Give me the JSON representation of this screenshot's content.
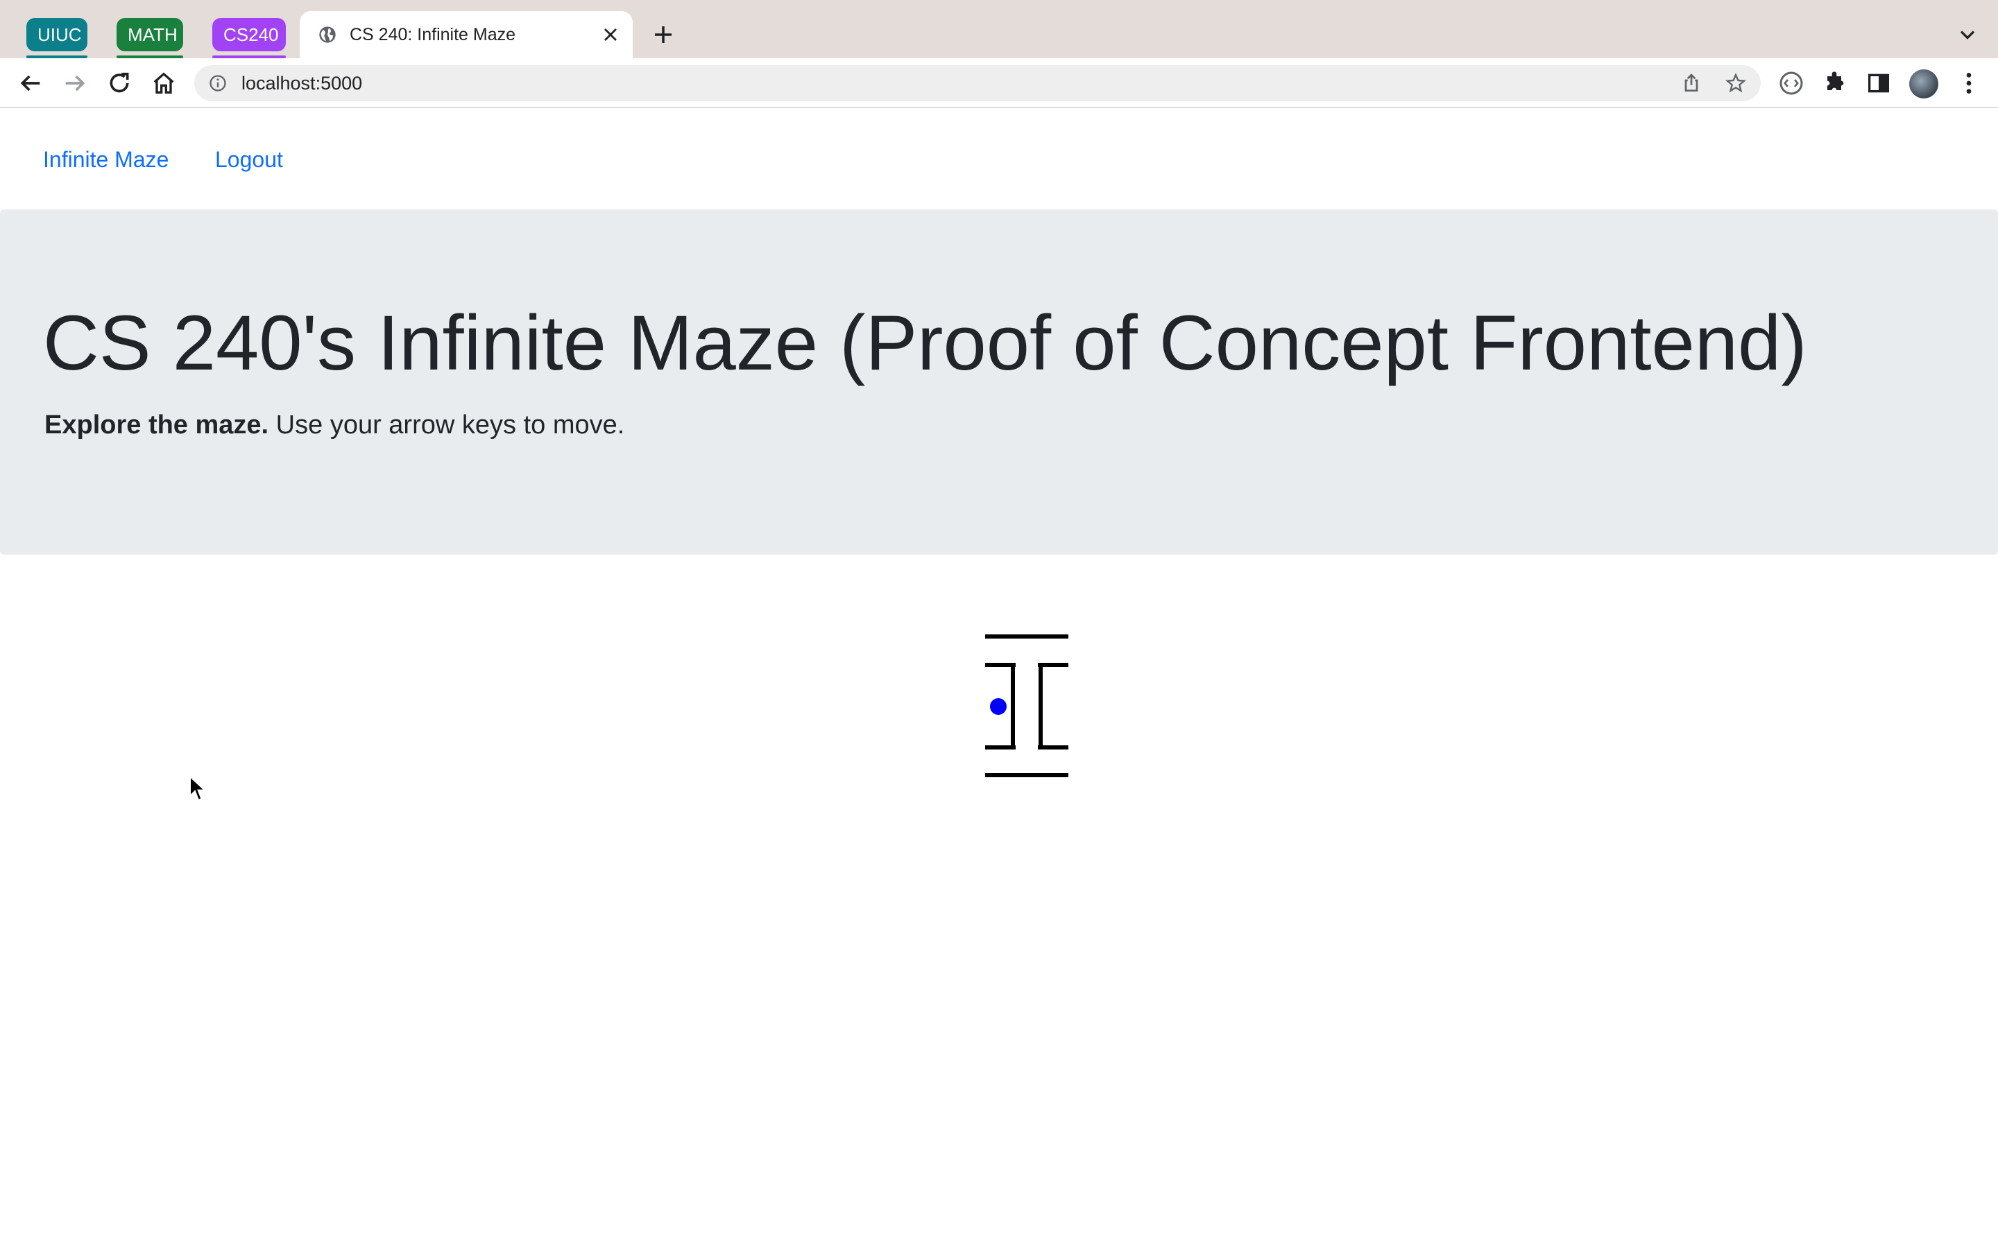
{
  "browser": {
    "tab_groups": [
      {
        "label": "UIUC",
        "color": "#0b7f8a"
      },
      {
        "label": "MATH",
        "color": "#19803d"
      },
      {
        "label": "CS240",
        "color": "#a142f4"
      }
    ],
    "active_tab": {
      "title": "CS 240: Infinite Maze"
    },
    "address_bar": {
      "url": "localhost:5000"
    }
  },
  "nav": {
    "brand": "Infinite Maze",
    "logout": "Logout"
  },
  "hero": {
    "title": "CS 240's Infinite Maze (Proof of Concept Frontend)",
    "lead_bold": "Explore the maze.",
    "lead_rest": " Use your arrow keys to move."
  },
  "maze": {
    "player_color": "#0000ff",
    "wall_color": "#000000"
  }
}
